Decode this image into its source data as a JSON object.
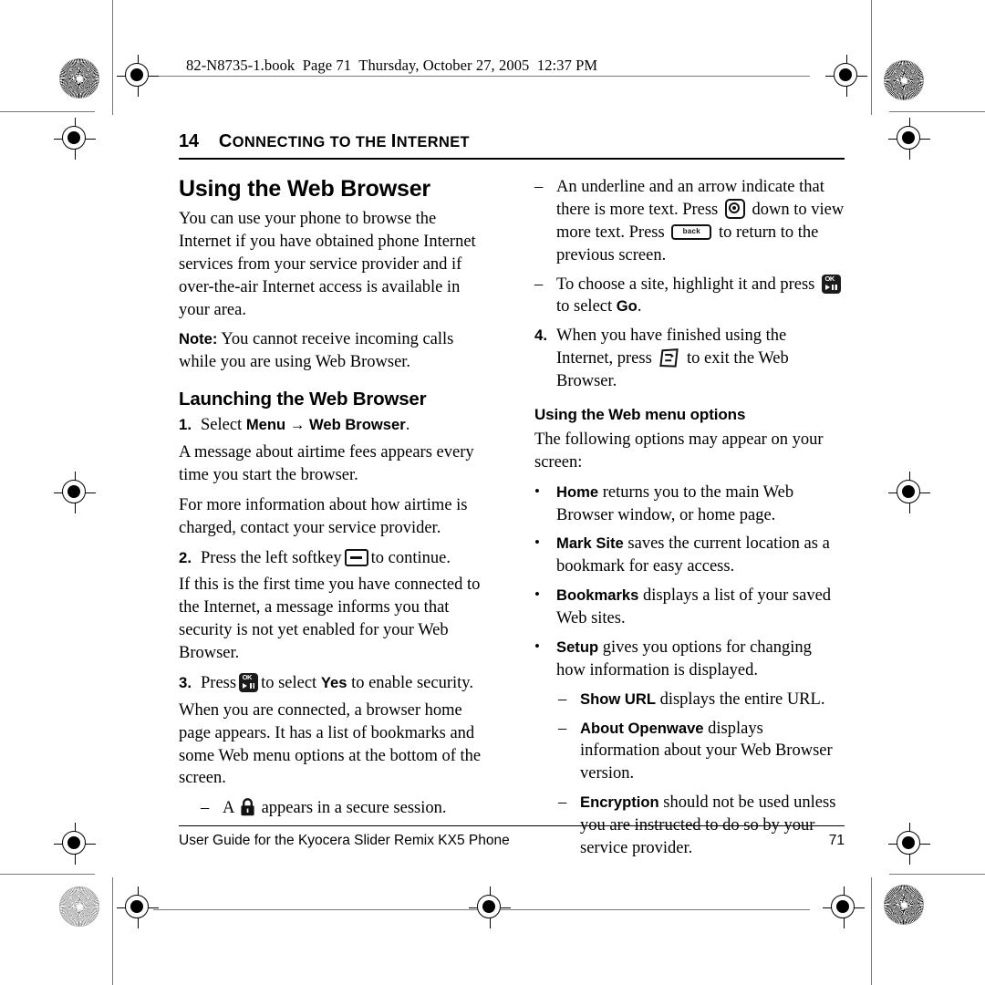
{
  "book_header": "82-N8735-1.book  Page 71  Thursday, October 27, 2005  12:37 PM",
  "chapter": {
    "number": "14",
    "title_first": "C",
    "title_rest": "ONNECTING TO THE ",
    "title_first2": "I",
    "title_rest2": "NTERNET"
  },
  "left": {
    "section_title": "Using the Web Browser",
    "intro": "You can use your phone to browse the Internet if you have obtained phone Internet services from your service provider and if over-the-air Internet access is available in your area.",
    "note_label": "Note:",
    "note_text": "You cannot receive incoming calls while you are using Web Browser.",
    "sub_title": "Launching the Web Browser",
    "step1": {
      "num": "1.",
      "pre": "Select ",
      "ui1": "Menu",
      "arrow": " → ",
      "ui2": "Web Browser",
      "post": "."
    },
    "step1_note1": "A message about airtime fees appears every time you start the browser.",
    "step1_note2": "For more information about how airtime is charged, contact your service provider.",
    "step2": {
      "num": "2.",
      "pre": "Press the left softkey",
      "icon": "left-softkey-icon",
      "post": "to continue."
    },
    "step2_note": "If this is the first time you have connected to the Internet, a message informs you that security is not yet enabled for your Web Browser.",
    "step3": {
      "num": "3.",
      "pre": "Press",
      "icon": "ok-key-icon",
      "mid": "to select ",
      "ui": "Yes",
      "post": " to enable security."
    },
    "step3_note": "When you are connected, a browser home page appears. It has a list of bookmarks and some Web menu options at the bottom of the screen.",
    "step3_dash": {
      "mark": "–",
      "pre": "A",
      "icon": "padlock-icon",
      "post": "appears in a secure session."
    }
  },
  "right": {
    "dash1": {
      "mark": "–",
      "part1": "An underline and an arrow indicate that there is more text. Press",
      "icon1": "navigation-key-icon",
      "part2": "down to view more text. Press",
      "icon2": "back-key-icon",
      "part3": "to return to the previous screen."
    },
    "dash2": {
      "mark": "–",
      "part1": "To choose a site, highlight it and press",
      "icon": "ok-key-icon",
      "part2": "to select ",
      "ui": "Go",
      "part3": "."
    },
    "step4": {
      "num": "4.",
      "part1": "When you have finished using the Internet, press",
      "icon": "end-key-icon",
      "part2": "to exit the Web Browser."
    },
    "menu_title": "Using the Web menu options",
    "menu_intro": "The following options may appear on your screen:",
    "bullets": [
      {
        "mark": "•",
        "term": "Home",
        "desc": " returns you to the main Web Browser window, or home page."
      },
      {
        "mark": "•",
        "term": "Mark Site",
        "desc": " saves the current location as a bookmark for easy access."
      },
      {
        "mark": "•",
        "term": "Bookmarks",
        "desc": " displays a list of your saved Web sites."
      },
      {
        "mark": "•",
        "term": "Setup",
        "desc": " gives you options for changing how information is displayed."
      }
    ],
    "sub_dashes": [
      {
        "mark": "–",
        "term": "Show URL",
        "desc": " displays the entire URL."
      },
      {
        "mark": "–",
        "term": "About Openwave",
        "desc": " displays information about your Web Browser version."
      },
      {
        "mark": "–",
        "term": "Encryption",
        "desc": " should not be used unless you are instructed to do so by your service provider."
      }
    ]
  },
  "footer": {
    "text": "User Guide for the Kyocera Slider Remix KX5 Phone",
    "page": "71"
  }
}
